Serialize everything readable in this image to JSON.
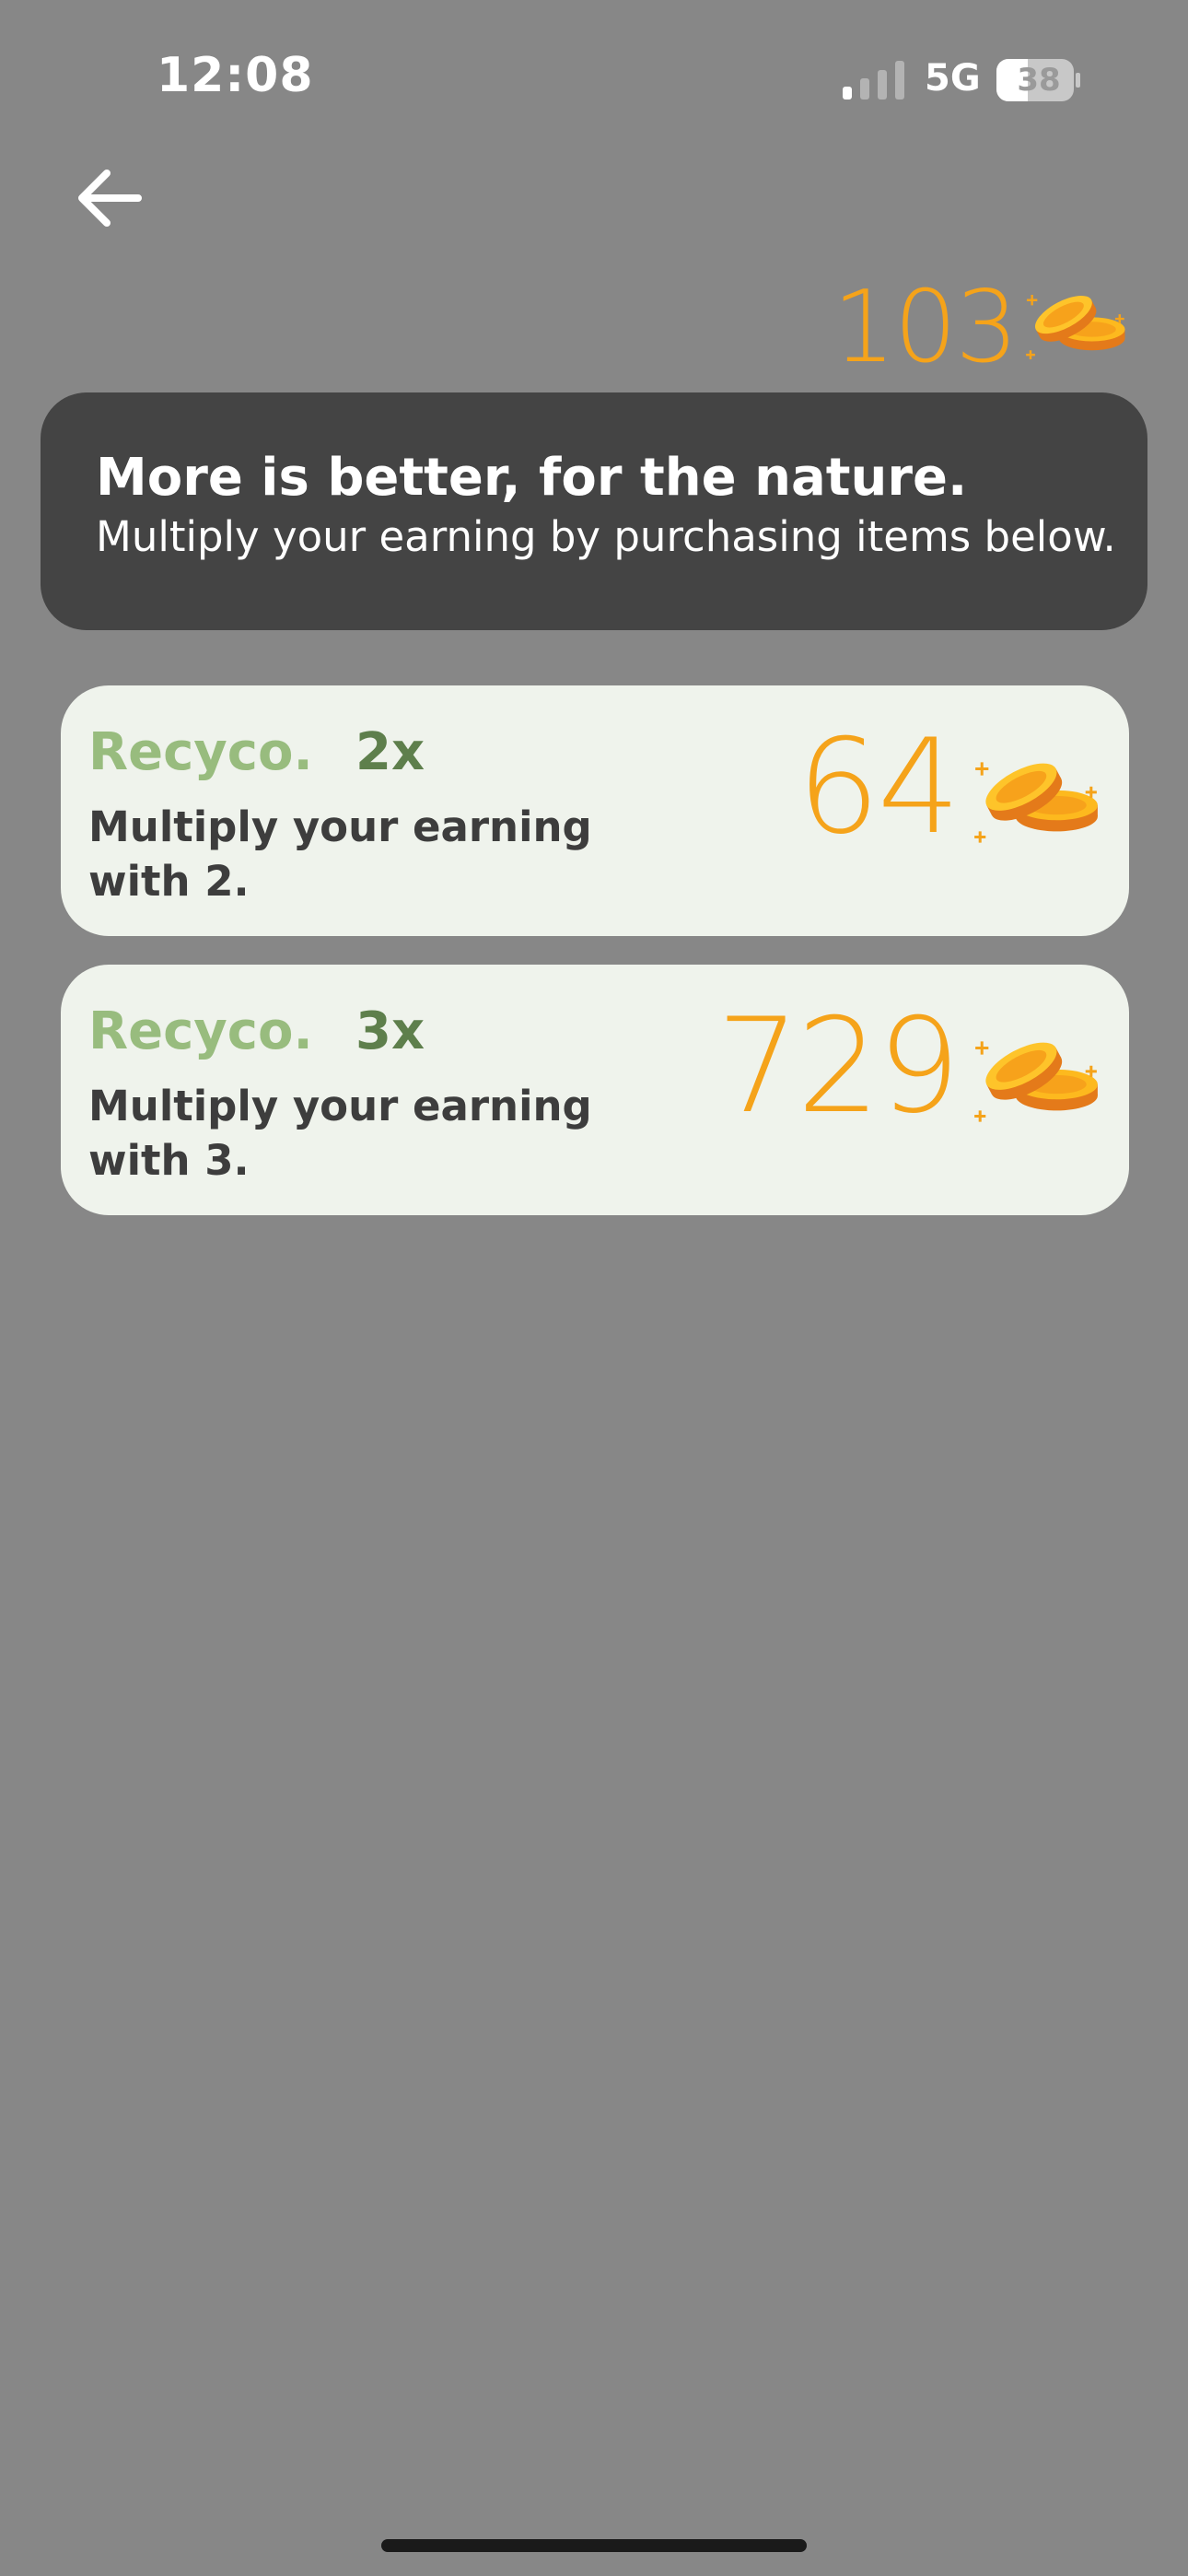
{
  "status_bar": {
    "time": "12:08",
    "network": "5G",
    "battery": "38"
  },
  "balance": {
    "value": "103",
    "icon": "coins-icon"
  },
  "banner": {
    "title": "More is better, for the nature.",
    "subtitle": "Multiply your earning by purchasing items below."
  },
  "items": [
    {
      "brand": "Recyco.",
      "multiplier": "2x",
      "description": "Multiply your earning with 2.",
      "price": "64"
    },
    {
      "brand": "Recyco.",
      "multiplier": "3x",
      "description": "Multiply your earning with 3.",
      "price": "729"
    }
  ],
  "colors": {
    "background": "#878787",
    "banner": "#444444",
    "card": "#eff3ec",
    "brand_green": "#98bc7e",
    "multiplier_green": "#5e7f4c",
    "coin_orange": "#f5a31a"
  }
}
